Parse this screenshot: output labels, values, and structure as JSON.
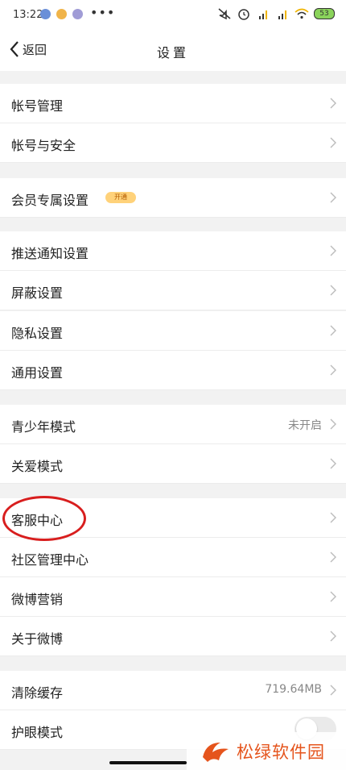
{
  "status_bar": {
    "time": "13:22",
    "more": "•••",
    "battery": "53"
  },
  "nav": {
    "back_label": "返回",
    "title": "设置"
  },
  "sections": [
    {
      "items": [
        {
          "label": "帐号管理"
        },
        {
          "label": "帐号与安全"
        }
      ]
    },
    {
      "items": [
        {
          "label": "会员专属设置",
          "badge": "开通"
        }
      ]
    },
    {
      "items": [
        {
          "label": "推送通知设置"
        },
        {
          "label": "屏蔽设置"
        },
        {
          "label": "隐私设置"
        },
        {
          "label": "通用设置"
        }
      ]
    },
    {
      "items": [
        {
          "label": "青少年模式",
          "value": "未开启"
        },
        {
          "label": "关爱模式"
        }
      ]
    },
    {
      "items": [
        {
          "label": "客服中心"
        },
        {
          "label": "社区管理中心"
        },
        {
          "label": "微博营销"
        },
        {
          "label": "关于微博"
        }
      ]
    },
    {
      "items": [
        {
          "label": "清除缓存",
          "value": "719.64MB"
        },
        {
          "label": "护眼模式",
          "toggle": false
        }
      ]
    }
  ],
  "watermark": {
    "text": "松绿软件园"
  },
  "colors": {
    "accent_red": "#d81e1e",
    "watermark_orange": "#e5541c"
  }
}
